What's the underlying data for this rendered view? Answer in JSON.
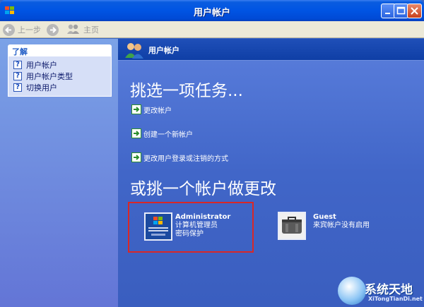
{
  "window": {
    "title": "用户帐户"
  },
  "toolbar": {
    "back_label": "上一步",
    "home_label": "主页"
  },
  "learn": {
    "heading": "了解",
    "items": [
      {
        "label": "用户帐户"
      },
      {
        "label": "用户帐户类型"
      },
      {
        "label": "切换用户"
      }
    ]
  },
  "header": {
    "title": "用户帐户"
  },
  "main": {
    "pick_task_title": "挑选一项任务...",
    "tasks": [
      {
        "label": "更改帐户"
      },
      {
        "label": "创建一个新帐户"
      },
      {
        "label": "更改用户登录或注销的方式"
      }
    ],
    "or_pick_title": "或挑一个帐户做更改",
    "accounts": [
      {
        "name": "Administrator",
        "line1": "计算机管理员",
        "line2": "密码保护"
      },
      {
        "name": "Guest",
        "line1": "来宾帐户没有启用"
      }
    ]
  },
  "watermark": {
    "title": "系统天地",
    "url": "XiTongTianDi.net"
  },
  "colors": {
    "titlebar": "#0054e3",
    "left_panel": "#6f8fe0",
    "right_panel": "#4166c8",
    "highlight_border": "#d92727"
  }
}
